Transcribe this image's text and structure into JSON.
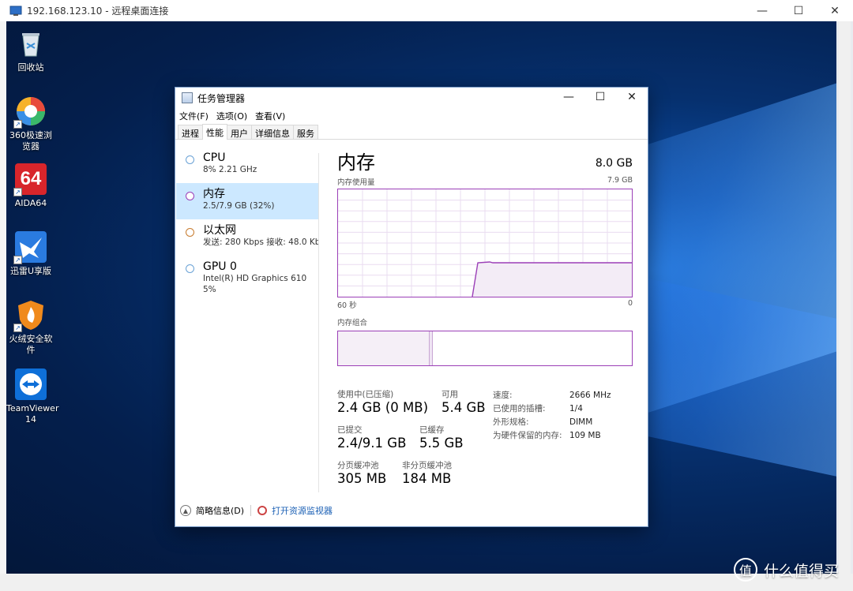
{
  "rdp": {
    "title": "192.168.123.10 - 远程桌面连接",
    "minimize": "—",
    "maximize": "☐",
    "close": "✕"
  },
  "desktop_icons": [
    {
      "label": "回收站",
      "icon": "recycle-bin-icon"
    },
    {
      "label": "360极速浏览器",
      "icon": "browser-icon"
    },
    {
      "label": "AIDA64",
      "icon": "aida64-icon",
      "glyph": "64"
    },
    {
      "label": "迅雷U享版",
      "icon": "xunlei-icon"
    },
    {
      "label": "火绒安全软件",
      "icon": "huorong-icon"
    },
    {
      "label": "TeamViewer 14",
      "icon": "teamviewer-icon"
    }
  ],
  "taskmgr": {
    "title": "任务管理器",
    "menu": [
      "文件(F)",
      "选项(O)",
      "查看(V)"
    ],
    "tabs": [
      "进程",
      "性能",
      "用户",
      "详细信息",
      "服务"
    ],
    "active_tab": "性能",
    "sidebar": [
      {
        "name": "CPU",
        "sub": "8% 2.21 GHz",
        "color": "#6aa2d6"
      },
      {
        "name": "内存",
        "sub": "2.5/7.9 GB (32%)",
        "color": "#9b3fb7"
      },
      {
        "name": "以太网",
        "sub": "发送: 280 Kbps 接收: 48.0 Kb",
        "color": "#c77b2e"
      },
      {
        "name": "GPU 0",
        "sub": "Intel(R) HD Graphics 610",
        "sub2": "5%",
        "color": "#6aa2d6"
      }
    ],
    "main": {
      "title": "内存",
      "total": "8.0 GB",
      "usage_label": "内存使用量",
      "usage_max": "7.9 GB",
      "axis_left": "60 秒",
      "axis_right": "0",
      "composition_label": "内存组合",
      "in_use_label": "使用中(已压缩)",
      "in_use_value": "2.4 GB (0 MB)",
      "available_label": "可用",
      "available_value": "5.4 GB",
      "committed_label": "已提交",
      "committed_value": "2.4/9.1 GB",
      "cached_label": "已缓存",
      "cached_value": "5.5 GB",
      "paged_label": "分页缓冲池",
      "paged_value": "305 MB",
      "nonpaged_label": "非分页缓冲池",
      "nonpaged_value": "184 MB",
      "specs": [
        {
          "k": "速度:",
          "v": "2666 MHz"
        },
        {
          "k": "已使用的插槽:",
          "v": "1/4"
        },
        {
          "k": "外形规格:",
          "v": "DIMM"
        },
        {
          "k": "为硬件保留的内存:",
          "v": "109 MB"
        }
      ]
    },
    "footer": {
      "brief": "简略信息(D)",
      "monitor": "打开资源监视器"
    },
    "accent": "#9b3fb7"
  },
  "watermark": "什么值得买",
  "watermark_glyph": "值"
}
